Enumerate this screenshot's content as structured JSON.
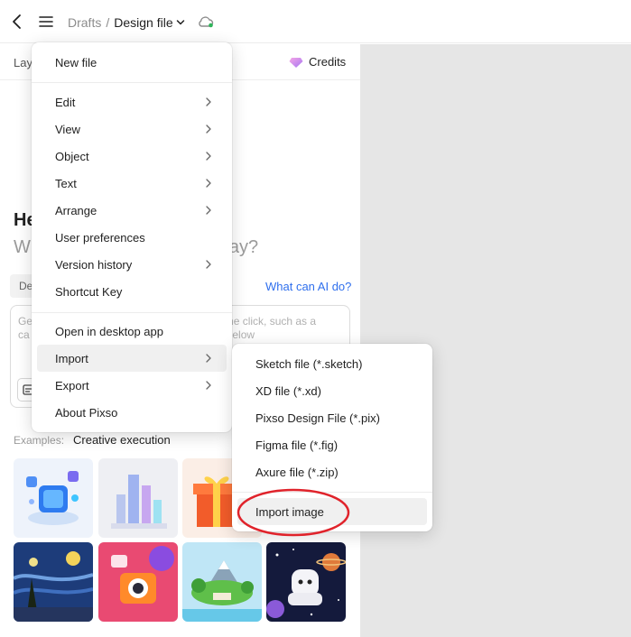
{
  "topbar": {
    "breadcrumb_root": "Drafts",
    "breadcrumb_separator": "/",
    "file_name": "Design file",
    "icons": [
      "chevron-left-icon",
      "hamburger-menu-icon",
      "chevron-down-icon",
      "cloud-sync-icon"
    ]
  },
  "panel": {
    "tab_layers": "Lay",
    "credits_label": "Credits",
    "greeting_line1": "He",
    "greeting_line2": "W",
    "greeting_line2_tail": "ay?",
    "mode_chip": "De",
    "ai_link": "What can AI do?",
    "prompt_line1_left": "Ge",
    "prompt_line1_right": "ne click, such as a",
    "prompt_line2_left": "ca",
    "prompt_line2_right": "below",
    "examples_label": "Examples:",
    "examples_value": "Creative execution",
    "thumbnails": [
      "AI 3D icon",
      "glass city",
      "gift box",
      "starry night",
      "camera character",
      "floating island",
      "astronaut"
    ]
  },
  "menu": {
    "items": [
      {
        "label": "New file",
        "has_submenu": false
      },
      {
        "label": "Edit",
        "has_submenu": true
      },
      {
        "label": "View",
        "has_submenu": true
      },
      {
        "label": "Object",
        "has_submenu": true
      },
      {
        "label": "Text",
        "has_submenu": true
      },
      {
        "label": "Arrange",
        "has_submenu": true
      },
      {
        "label": "User preferences",
        "has_submenu": false
      },
      {
        "label": "Version history",
        "has_submenu": true
      },
      {
        "label": "Shortcut Key",
        "has_submenu": false
      },
      {
        "label": "Open in desktop app",
        "has_submenu": false
      },
      {
        "label": "Import",
        "has_submenu": true
      },
      {
        "label": "Export",
        "has_submenu": true
      },
      {
        "label": "About Pixso",
        "has_submenu": false
      }
    ]
  },
  "submenu": {
    "items": [
      {
        "label": "Sketch file (*.sketch)"
      },
      {
        "label": "XD file (*.xd)"
      },
      {
        "label": "Pixso Design File (*.pix)"
      },
      {
        "label": "Figma file (*.fig)"
      },
      {
        "label": "Axure file (*.zip)"
      },
      {
        "label": "Import image"
      }
    ]
  },
  "colors": {
    "accent_link": "#2f6fed",
    "highlight_ring": "#e0232b",
    "canvas": "#e6e6e6",
    "menu_hover": "#f0f0f0"
  }
}
